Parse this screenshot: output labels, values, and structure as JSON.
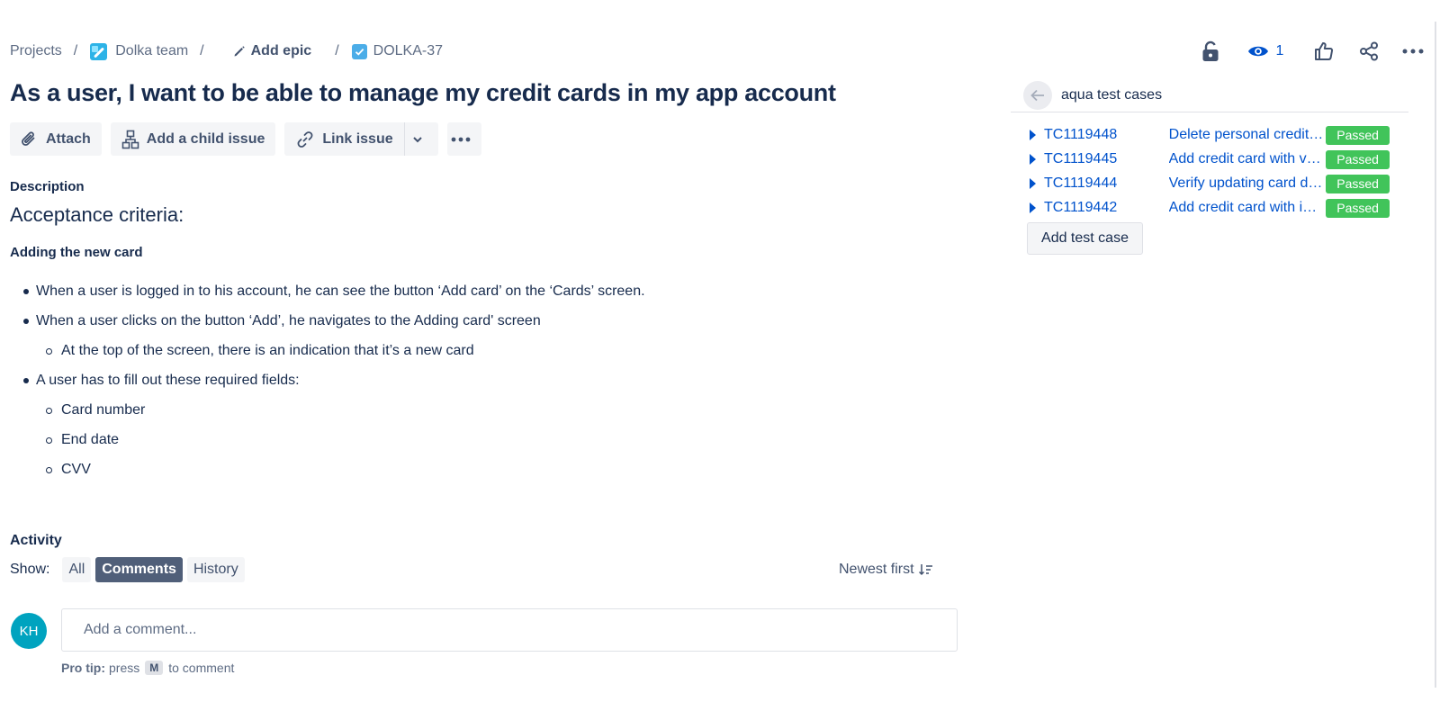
{
  "breadcrumb": {
    "projects": "Projects",
    "separator": "/",
    "team": "Dolka team",
    "epic": "Add epic",
    "issue_key": "DOLKA-37"
  },
  "top_actions": {
    "watch_count": "1",
    "icons": [
      "lock-icon",
      "eye-icon",
      "thumbs-up-icon",
      "share-icon",
      "more-icon"
    ]
  },
  "issue": {
    "title": "As a user, I want to be able to manage my credit cards in my app account"
  },
  "toolbar": {
    "attach": "Attach",
    "add_child": "Add a child issue",
    "link_issue": "Link issue"
  },
  "description": {
    "label": "Description",
    "heading": "Acceptance criteria:",
    "subheading": "Adding the new card",
    "items": [
      "When a user is logged in to his account, he can see the button ‘Add card’ on the ‘Cards’ screen.",
      "When a user clicks on the button ‘Add’, he navigates to the Adding card' screen",
      "At the top of the screen, there is an indication that it’s a new card",
      "A user has to fill out these required fields:",
      "Card number",
      "End date",
      "CVV"
    ]
  },
  "activity": {
    "label": "Activity",
    "show_label": "Show:",
    "filters": [
      "All",
      "Comments",
      "History"
    ],
    "active_filter": "Comments",
    "sort": "Newest first",
    "avatar_initials": "KH",
    "comment_placeholder": "Add a comment...",
    "protip_bold": "Pro tip:",
    "protip_press": "press",
    "protip_key": "M",
    "protip_rest": "to comment"
  },
  "test_panel": {
    "title": "aqua test cases",
    "cases": [
      {
        "id": "TC1119448",
        "name": "Delete personal credit card",
        "status": "Passed"
      },
      {
        "id": "TC1119445",
        "name": "Add credit card with valid data",
        "status": "Passed"
      },
      {
        "id": "TC1119444",
        "name": "Verify updating card details",
        "status": "Passed"
      },
      {
        "id": "TC1119442",
        "name": "Add credit card with invalid data",
        "status": "Passed"
      }
    ],
    "add_button": "Add test case",
    "status_color": "#41c45a"
  },
  "colors": {
    "link": "#0052cc",
    "text": "#172b4d",
    "active_filter_bg": "#505f79",
    "avatar_bg": "#00a3bf"
  }
}
